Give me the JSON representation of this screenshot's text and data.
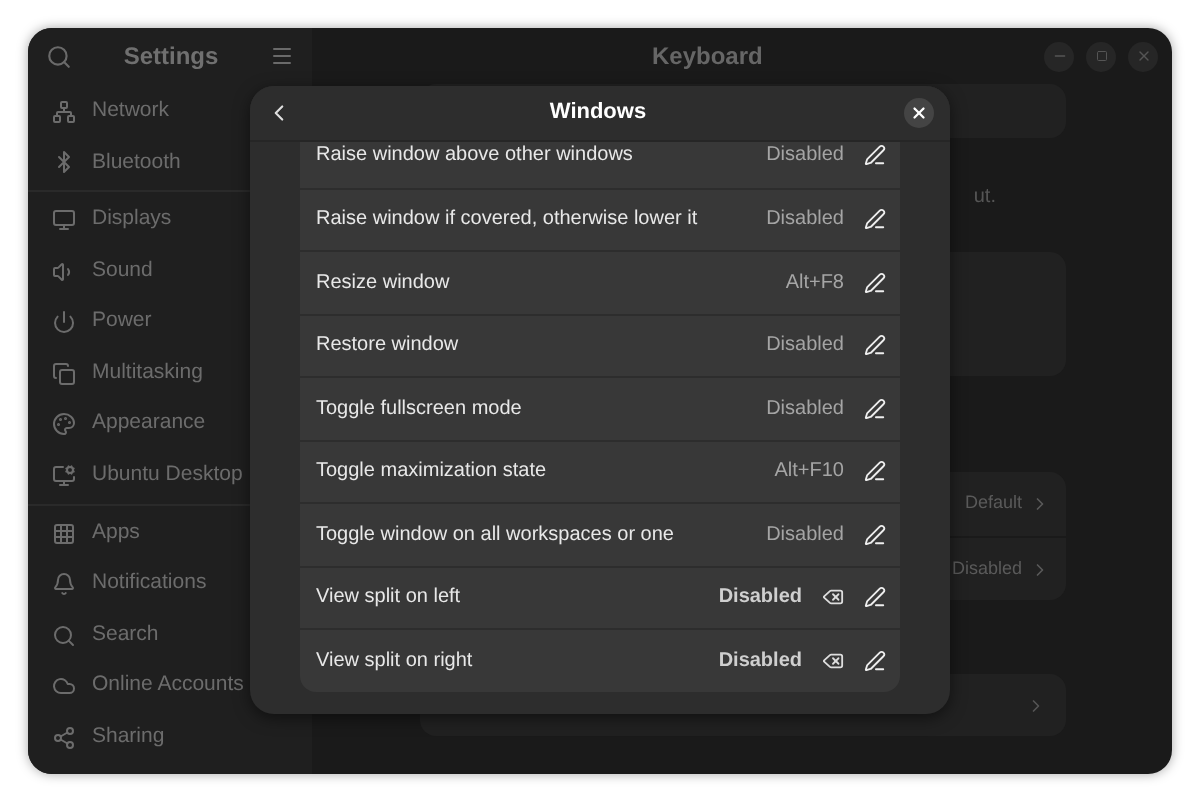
{
  "sidebar": {
    "title": "Settings",
    "groups": [
      [
        {
          "label": "Network"
        },
        {
          "label": "Bluetooth"
        }
      ],
      [
        {
          "label": "Displays"
        },
        {
          "label": "Sound"
        },
        {
          "label": "Power"
        },
        {
          "label": "Multitasking"
        },
        {
          "label": "Appearance"
        },
        {
          "label": "Ubuntu Desktop"
        }
      ],
      [
        {
          "label": "Apps"
        },
        {
          "label": "Notifications"
        },
        {
          "label": "Search"
        },
        {
          "label": "Online Accounts"
        },
        {
          "label": "Sharing"
        }
      ]
    ]
  },
  "main": {
    "title": "Keyboard",
    "note": "ut.",
    "rows": [
      {
        "value": "Default"
      },
      {
        "value": "Disabled"
      }
    ]
  },
  "dialog": {
    "title": "Windows",
    "shortcuts": [
      {
        "name": "Raise window above other windows",
        "value": "Disabled",
        "custom": false
      },
      {
        "name": "Raise window if covered, otherwise lower it",
        "value": "Disabled",
        "custom": false
      },
      {
        "name": "Resize window",
        "value": "Alt+F8",
        "custom": false
      },
      {
        "name": "Restore window",
        "value": "Disabled",
        "custom": false
      },
      {
        "name": "Toggle fullscreen mode",
        "value": "Disabled",
        "custom": false
      },
      {
        "name": "Toggle maximization state",
        "value": "Alt+F10",
        "custom": false
      },
      {
        "name": "Toggle window on all workspaces or one",
        "value": "Disabled",
        "custom": false
      },
      {
        "name": "View split on left",
        "value": "Disabled",
        "custom": true
      },
      {
        "name": "View split on right",
        "value": "Disabled",
        "custom": true
      }
    ]
  }
}
